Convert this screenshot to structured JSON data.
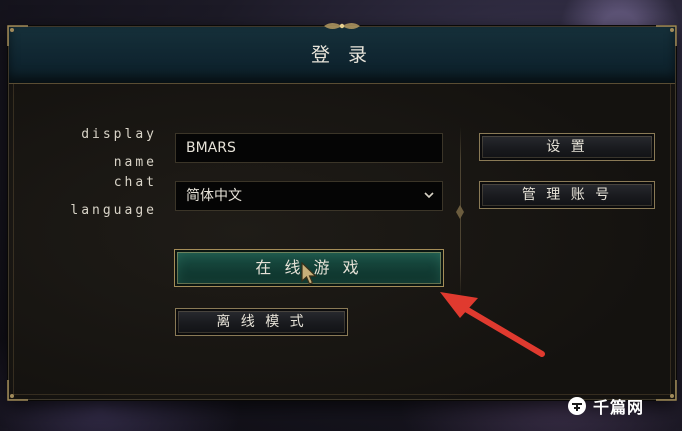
{
  "dialog": {
    "title": "登 录"
  },
  "form": {
    "display_name_label_line1": "display",
    "display_name_label_line2": "name",
    "display_name_value": "BMARS",
    "chat_language_label_line1": "chat",
    "chat_language_label_line2": "language",
    "chat_language_value": "简体中文"
  },
  "buttons": {
    "online_play": "在 线 游 戏",
    "offline_mode": "离 线 模 式",
    "settings": "设 置",
    "manage_account": "管 理 账 号"
  },
  "icons": {
    "dropdown": "chevron-down-icon",
    "cursor": "mouse-pointer-icon",
    "annotation": "red-arrow-icon",
    "watermark": "qianpian-logo-icon"
  },
  "watermark": {
    "text": "千篇网"
  },
  "colors": {
    "header_bg": "#0f2530",
    "primary_button": "#1d5549",
    "gold_border": "#8a7a56",
    "annotation_arrow": "#e03a2f"
  }
}
